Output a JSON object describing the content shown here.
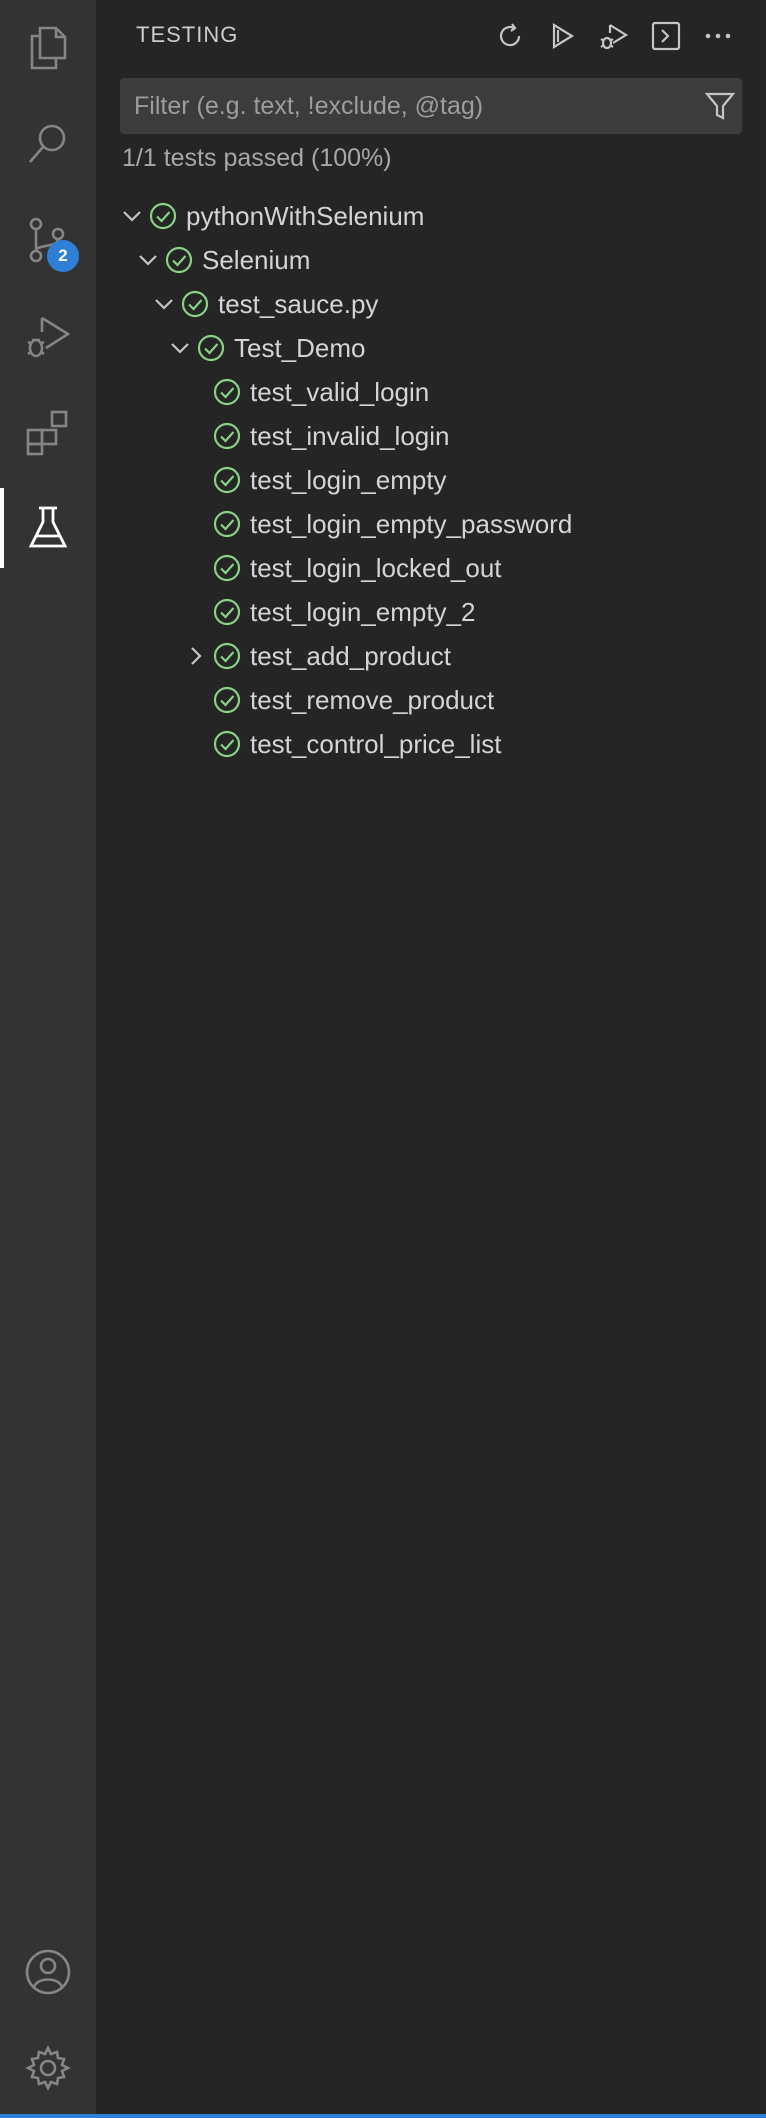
{
  "activity_bar": {
    "items": [
      {
        "name": "explorer",
        "icon": "files-icon"
      },
      {
        "name": "search",
        "icon": "search-icon"
      },
      {
        "name": "source-control",
        "icon": "source-control-icon",
        "badge": "2"
      },
      {
        "name": "run-debug",
        "icon": "run-debug-icon"
      },
      {
        "name": "extensions",
        "icon": "extensions-icon"
      },
      {
        "name": "testing",
        "icon": "beaker-icon",
        "active": true
      }
    ],
    "bottom": [
      {
        "name": "accounts",
        "icon": "account-icon"
      },
      {
        "name": "manage",
        "icon": "gear-icon"
      }
    ]
  },
  "panel": {
    "title": "TESTING",
    "actions": [
      "refresh-icon",
      "run-all-icon",
      "debug-all-icon",
      "terminal-icon",
      "more-icon"
    ],
    "filter_placeholder": "Filter (e.g. text, !exclude, @tag)",
    "summary": "1/1 tests passed (100%)"
  },
  "tree": [
    {
      "label": "pythonWithSelenium",
      "depth": 0,
      "expanded": true,
      "status": "passed"
    },
    {
      "label": "Selenium",
      "depth": 1,
      "expanded": true,
      "status": "passed"
    },
    {
      "label": "test_sauce.py",
      "depth": 2,
      "expanded": true,
      "status": "passed"
    },
    {
      "label": "Test_Demo",
      "depth": 3,
      "expanded": true,
      "status": "passed"
    },
    {
      "label": "test_valid_login",
      "depth": 4,
      "status": "passed"
    },
    {
      "label": "test_invalid_login",
      "depth": 4,
      "status": "passed"
    },
    {
      "label": "test_login_empty",
      "depth": 4,
      "status": "passed"
    },
    {
      "label": "test_login_empty_password",
      "depth": 4,
      "status": "passed"
    },
    {
      "label": "test_login_locked_out",
      "depth": 4,
      "status": "passed"
    },
    {
      "label": "test_login_empty_2",
      "depth": 4,
      "status": "passed"
    },
    {
      "label": "test_add_product",
      "depth": 4,
      "expanded": false,
      "status": "passed"
    },
    {
      "label": "test_remove_product",
      "depth": 4,
      "status": "passed"
    },
    {
      "label": "test_control_price_list",
      "depth": 4,
      "status": "passed"
    }
  ],
  "colors": {
    "accent": "#2f7fd6",
    "passed": "#89d185",
    "icon": "#c5c5c5",
    "icon_dim": "#858585"
  }
}
